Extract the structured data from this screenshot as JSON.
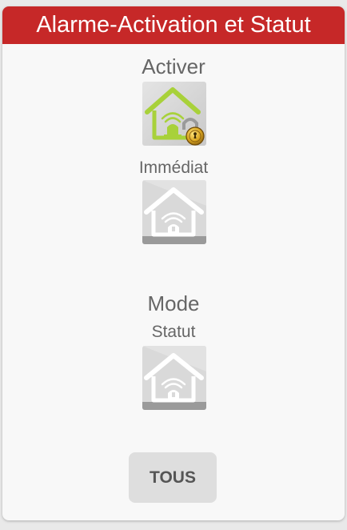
{
  "card": {
    "title": "Alarme-Activation et Statut",
    "accent_color": "#c62828"
  },
  "activer": {
    "label": "Activer",
    "icon": "house-alarm-armed-padlock-icon",
    "icon_color": "#a8d13a"
  },
  "immediat": {
    "label": "Immédiat",
    "icon": "house-alarm-icon"
  },
  "mode": {
    "label": "Mode"
  },
  "statut": {
    "label": "Statut",
    "icon": "house-alarm-icon"
  },
  "tous_button": {
    "label": "TOUS"
  }
}
